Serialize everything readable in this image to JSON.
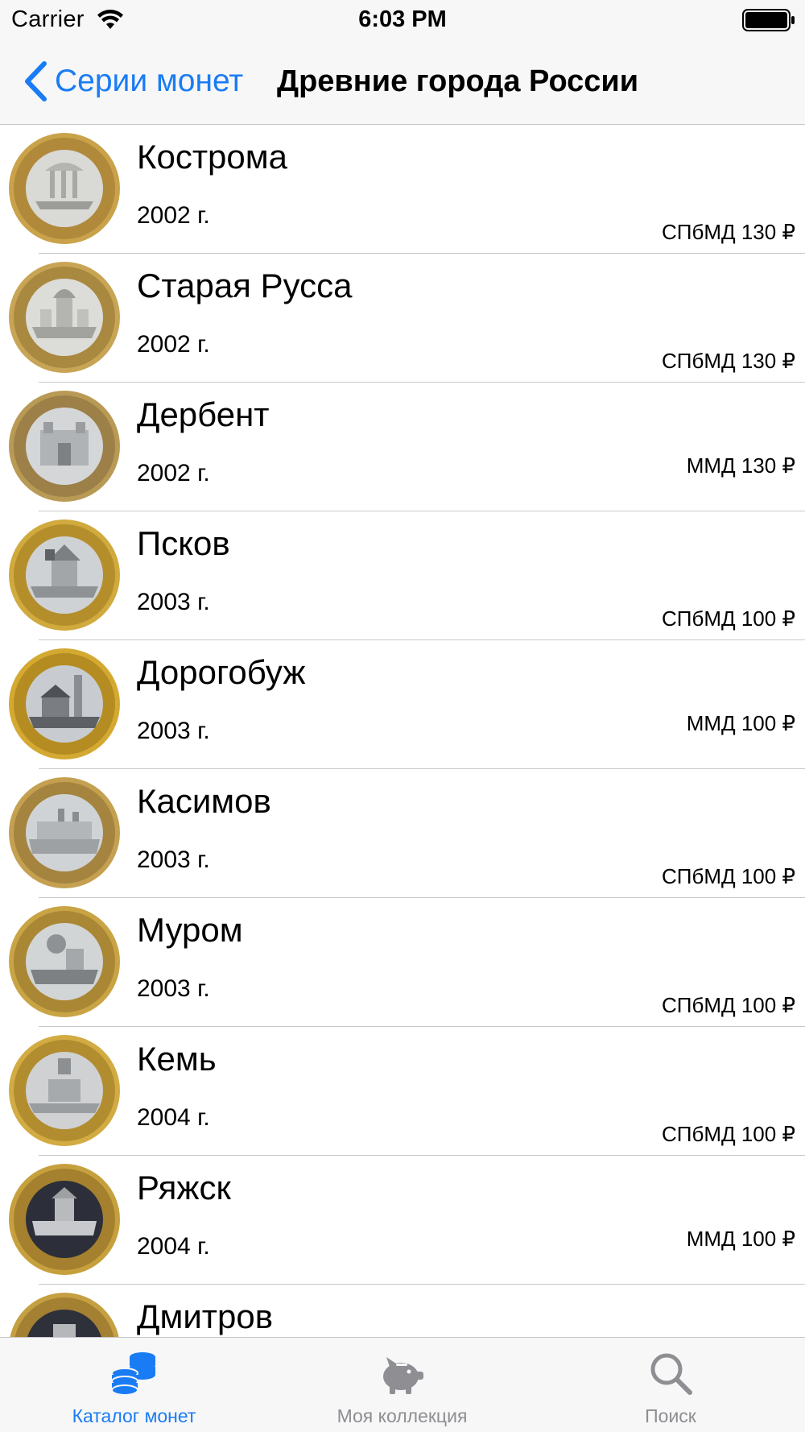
{
  "status_bar": {
    "carrier": "Carrier",
    "time": "6:03 PM"
  },
  "nav": {
    "back_label": "Серии монет",
    "title": "Древние города России"
  },
  "coins": [
    {
      "title": "Кострома",
      "year": "2002 г.",
      "price": "СПбМД 130 ₽"
    },
    {
      "title": "Старая Русса",
      "year": "2002 г.",
      "price": "СПбМД 130 ₽"
    },
    {
      "title": "Дербент",
      "year": "2002 г.",
      "price": "ММД 130 ₽"
    },
    {
      "title": "Псков",
      "year": "2003 г.",
      "price": "СПбМД 100 ₽"
    },
    {
      "title": "Дорогобуж",
      "year": "2003 г.",
      "price": "ММД 100 ₽"
    },
    {
      "title": "Касимов",
      "year": "2003 г.",
      "price": "СПбМД 100 ₽"
    },
    {
      "title": "Муром",
      "year": "2003 г.",
      "price": "СПбМД 100 ₽"
    },
    {
      "title": "Кемь",
      "year": "2004 г.",
      "price": "СПбМД 100 ₽"
    },
    {
      "title": "Ряжск",
      "year": "2004 г.",
      "price": "ММД 100 ₽"
    },
    {
      "title": "Дмитров",
      "year": "",
      "price": ""
    }
  ],
  "tabs": [
    {
      "label": "Каталог монет",
      "icon": "coins-stack-icon",
      "active": true
    },
    {
      "label": "Моя коллекция",
      "icon": "piggy-bank-icon",
      "active": false
    },
    {
      "label": "Поиск",
      "icon": "search-icon",
      "active": false
    }
  ],
  "colors": {
    "accent": "#1a7cf5",
    "inactive_tab": "#8e8e93",
    "separator": "#c8c7cc",
    "bar_background": "#f7f7f7"
  }
}
